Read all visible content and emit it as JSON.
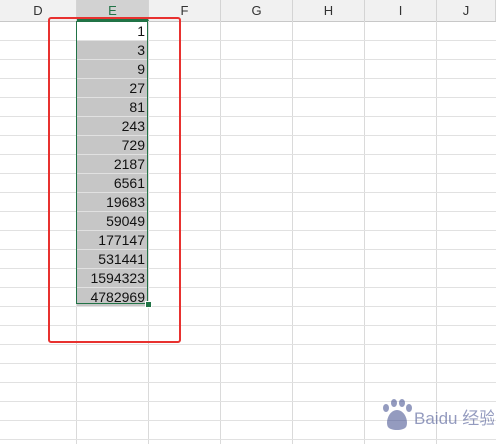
{
  "columns": [
    "D",
    "E",
    "F",
    "G",
    "H",
    "I",
    "J"
  ],
  "selected_column": "E",
  "cells": [
    "1",
    "3",
    "9",
    "27",
    "81",
    "243",
    "729",
    "2187",
    "6561",
    "19683",
    "59049",
    "177147",
    "531441",
    "1594323",
    "4782969"
  ],
  "colors": {
    "selection_border": "#217346",
    "selected_fill": "#c6c6c6",
    "annotation_red": "#e8312f",
    "header_bg": "#f1f1f1"
  },
  "watermark": "Baidu 经验"
}
